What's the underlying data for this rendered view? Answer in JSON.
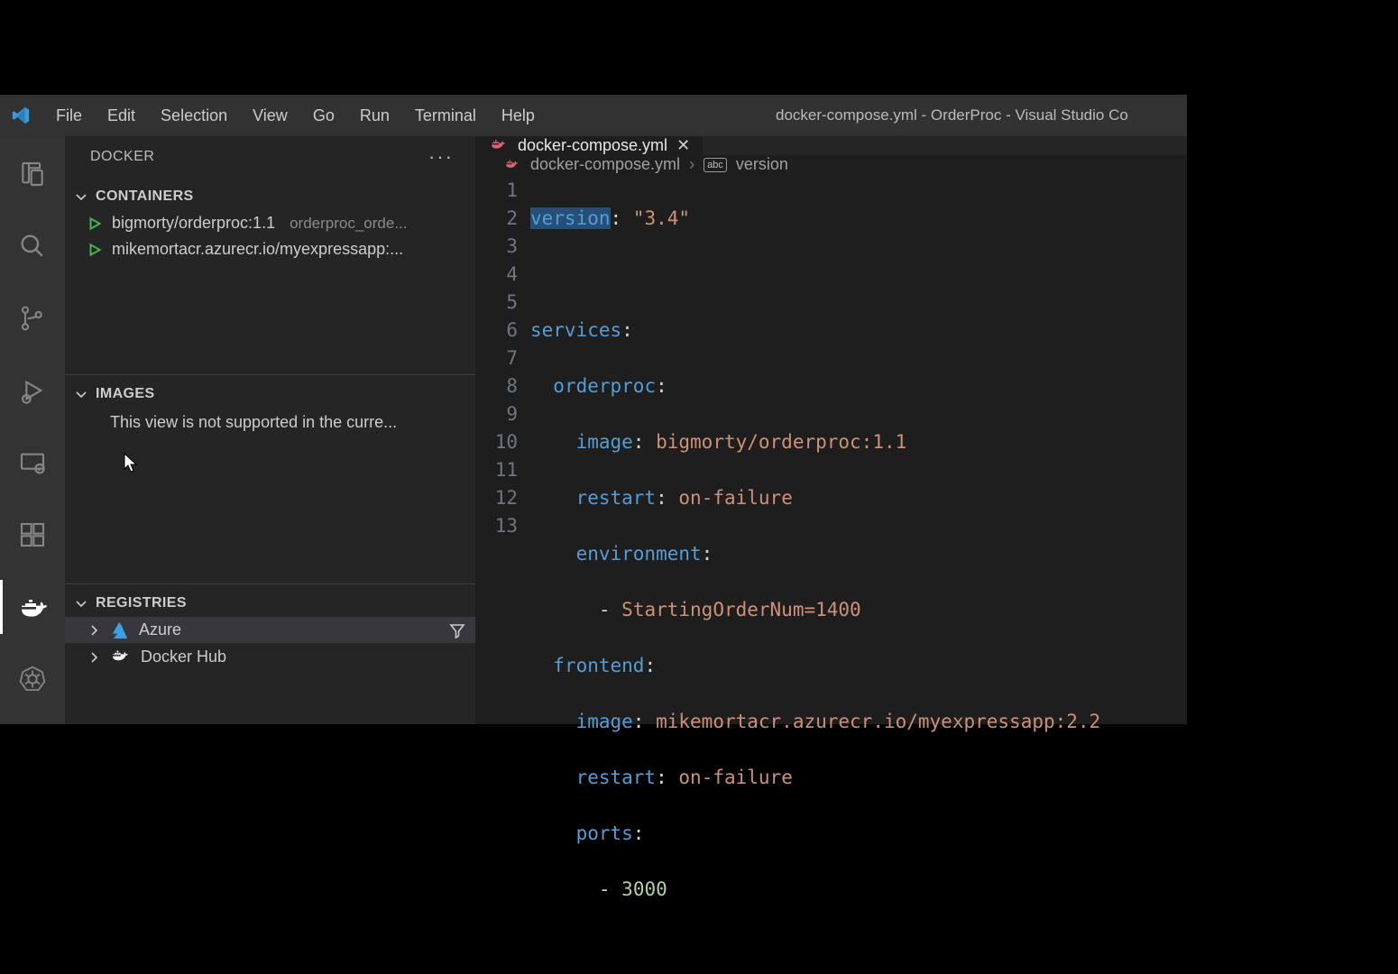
{
  "window_title": "docker-compose.yml - OrderProc - Visual Studio Co",
  "menu": [
    "File",
    "Edit",
    "Selection",
    "View",
    "Go",
    "Run",
    "Terminal",
    "Help"
  ],
  "sidebar": {
    "title": "DOCKER",
    "sections": {
      "containers": {
        "label": "Containers",
        "items": [
          {
            "name": "bigmorty/orderproc:1.1",
            "desc": "orderproc_orde..."
          },
          {
            "name": "mikemortacr.azurecr.io/myexpressapp:..."
          }
        ]
      },
      "images": {
        "label": "Images",
        "note": "This view is not supported in the curre..."
      },
      "registries": {
        "label": "Registries",
        "items": [
          {
            "name": "Azure",
            "icon": "azure",
            "selected": true,
            "filter": true
          },
          {
            "name": "Docker Hub",
            "icon": "whale"
          }
        ]
      }
    }
  },
  "tab": {
    "label": "docker-compose.yml"
  },
  "breadcrumb": {
    "file": "docker-compose.yml",
    "symbol": "version"
  },
  "code": {
    "line_count": 13,
    "raw": "version: \"3.4\"\n\nservices:\n  orderproc:\n    image: bigmorty/orderproc:1.1\n    restart: on-failure\n    environment:\n      - StartingOrderNum=1400\n  frontend:\n    image: mikemortacr.azurecr.io/myexpressapp:2.2\n    restart: on-failure\n    ports:\n      - 3000"
  }
}
